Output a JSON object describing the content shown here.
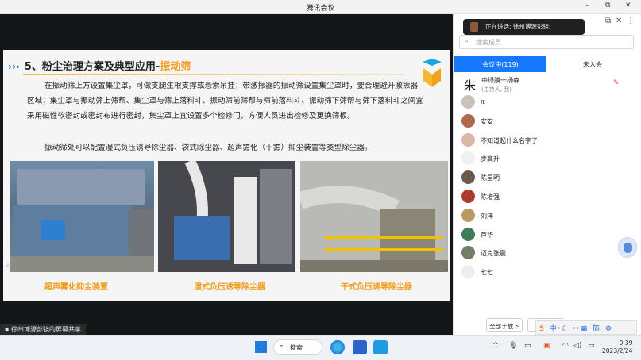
{
  "window": {
    "title": "腾讯会议",
    "minimize": "–",
    "restore": "⧉",
    "close": "✕"
  },
  "slide": {
    "arrows": "›››",
    "heading_prefix": "5、粉尘治理方案及典型应用-",
    "heading_highlight": "振动筛",
    "paragraph1": "在振动筛上方设置集尘罩，可做支腿生根支撑或悬索吊挂；带激振器的振动筛设置集尘罩时，要合理避开激振器区域；集尘罩与振动筛上筛帮、集尘罩与筛上落料斗、振动筛前筛帮与筛前落料斗、振动筛下筛帮与筛下落料斗之间宜采用磁性软密封或密封布进行密封，集尘罩上宜设置多个检修门，方便人员进出检修及更换筛板。",
    "paragraph2": "振动筛处可以配置湿式负压诱导除尘器、袋式除尘器、超声雾化（干雾）抑尘装置等类型除尘器。",
    "captions": [
      "超声雾化抑尘装置",
      "湿式负压诱导除尘器",
      "干式负压诱导除尘器"
    ]
  },
  "share_label": "徐州博源彭骁的屏幕共享",
  "speaking": {
    "text": "正在讲话: 徐州博源彭骁;"
  },
  "panel": {
    "search_placeholder": "搜索成员",
    "tabs": {
      "in_meeting": "会议中(119)",
      "not_joined": "未入会"
    },
    "host": {
      "avatar_char": "朱",
      "name": "中绿膜一杨森",
      "role": "(主持人, 我)"
    },
    "members": [
      {
        "name": "π",
        "color": "#c9c2b8"
      },
      {
        "name": "安安",
        "color": "#b2674f"
      },
      {
        "name": "不知道起什么名字了",
        "color": "#d9b7a9"
      },
      {
        "name": "步高升",
        "color": "#f0f0f0"
      },
      {
        "name": "陈星明",
        "color": "#6b5a4a"
      },
      {
        "name": "陈增强",
        "color": "#b0392e"
      },
      {
        "name": "刘洋",
        "color": "#b89a62"
      },
      {
        "name": "芦华",
        "color": "#3f7c5a"
      },
      {
        "name": "迈克张震",
        "color": "#708064"
      },
      {
        "name": "七七",
        "color": "#eeeeee"
      }
    ],
    "raise_all_down": "全部手放下"
  },
  "ime": {
    "text": "中⸱☾ ⸱⸱▦ 简 ⚙",
    "logo": "S"
  },
  "taskbar": {
    "search_label": "搜索",
    "time": "9:39",
    "date": "2023/2/24",
    "tray_chevron": "^"
  }
}
